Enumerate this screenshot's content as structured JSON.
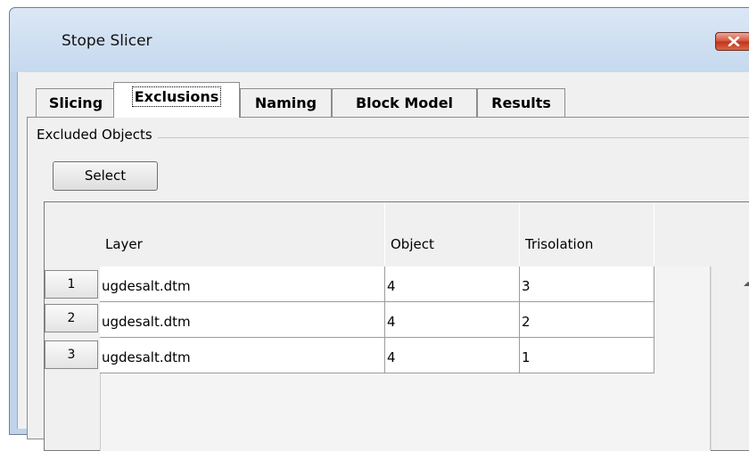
{
  "window": {
    "title": "Stope Slicer"
  },
  "tabs": [
    {
      "label": "Slicing",
      "active": false
    },
    {
      "label": "Exclusions",
      "active": true
    },
    {
      "label": "Naming",
      "active": false
    },
    {
      "label": "Block Model",
      "active": false
    },
    {
      "label": "Results",
      "active": false
    }
  ],
  "group": {
    "label": "Excluded Objects"
  },
  "select_button": {
    "label": "Select"
  },
  "table": {
    "columns": [
      "Layer",
      "Object",
      "Trisolation"
    ],
    "rows": [
      {
        "index": "1",
        "layer": "ugdesalt.dtm",
        "object": "4",
        "trisolation": "3"
      },
      {
        "index": "2",
        "layer": "ugdesalt.dtm",
        "object": "4",
        "trisolation": "2"
      },
      {
        "index": "3",
        "layer": "ugdesalt.dtm",
        "object": "4",
        "trisolation": "1"
      }
    ]
  },
  "icons": {
    "close": "close-icon",
    "scroll_up": "chevron-up-icon"
  },
  "colors": {
    "close_button": "#c9442a",
    "title_bar": "#c6d9ef",
    "panel": "#f0f0f0"
  }
}
